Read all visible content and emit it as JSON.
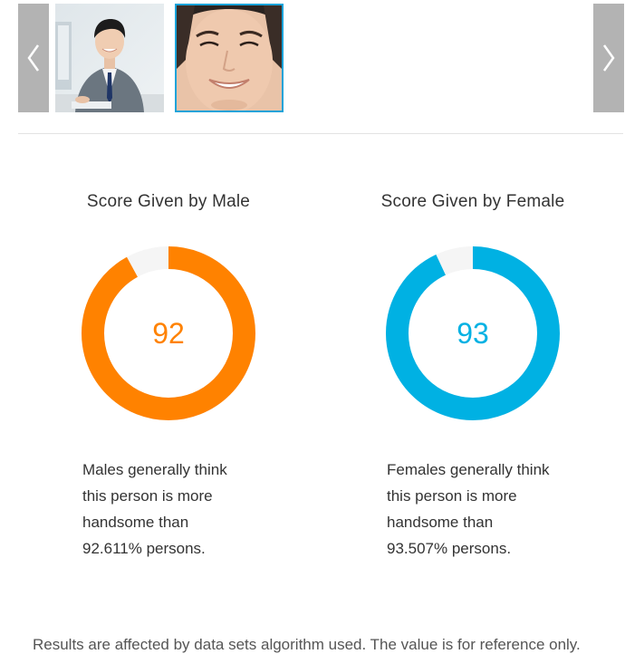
{
  "carousel": {
    "prev_icon": "chevron-left-icon",
    "next_icon": "chevron-right-icon",
    "arrow_color": "#b3b3b3",
    "selected_border_color": "#1aa3d9"
  },
  "male": {
    "title": "Score Given by Male",
    "score": "92",
    "score_fraction": 0.92,
    "color": "#ff8200",
    "track_color": "#f5f5f5",
    "desc_lines": [
      "Males generally think",
      "this person is more",
      "handsome than",
      "92.611% persons."
    ]
  },
  "female": {
    "title": "Score Given by Female",
    "score": "93",
    "score_fraction": 0.93,
    "color": "#00b1e3",
    "track_color": "#f5f5f5",
    "desc_lines": [
      "Females generally think",
      "this person is more",
      "handsome than",
      "93.507% persons."
    ]
  },
  "footer": {
    "disclaimer": "Results are affected by data sets algorithm used. The value is for reference only."
  }
}
